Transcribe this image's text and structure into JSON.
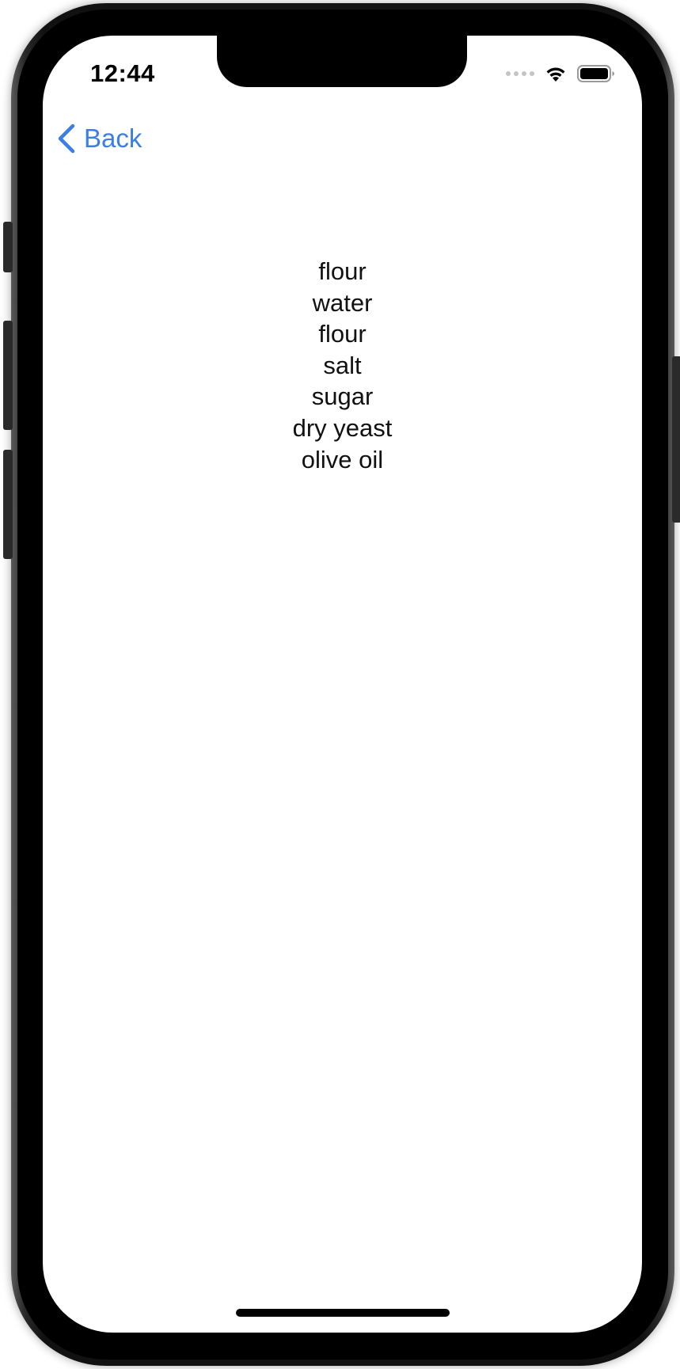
{
  "status_bar": {
    "time": "12:44",
    "signal_icon": "cellular-signal-icon",
    "wifi_icon": "wifi-icon",
    "battery_icon": "battery-icon"
  },
  "nav": {
    "back_label": "Back",
    "back_icon": "chevron-left-icon",
    "accent_color": "#3a7ee6"
  },
  "ingredients": [
    "flour",
    "water",
    "flour",
    "salt",
    "sugar",
    "dry yeast",
    "olive oil"
  ]
}
